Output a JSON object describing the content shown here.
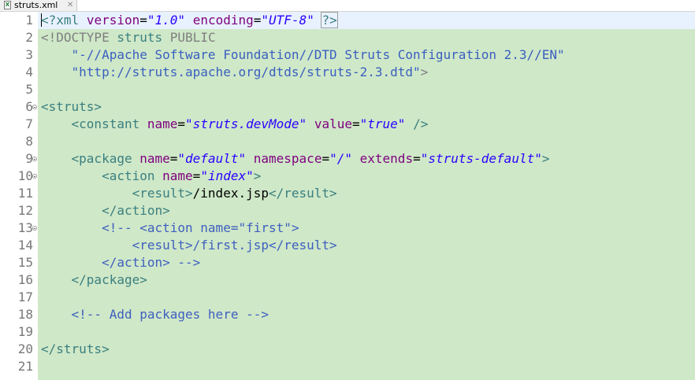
{
  "tab": {
    "file_icon": "X",
    "label": "struts.xml",
    "close_glyph": "✕"
  },
  "colors": {
    "editor_background": "#cfe8c8",
    "current_line": "#e8f2fe",
    "tag": "#3a7f7f",
    "attribute": "#7f007f",
    "attribute_value": "#2a00ff",
    "comment": "#3f5fbf"
  },
  "editor": {
    "current_line": 1,
    "line_numbers": [
      "1",
      "2",
      "3",
      "4",
      "5",
      "6",
      "7",
      "8",
      "9",
      "10",
      "11",
      "12",
      "13",
      "14",
      "15",
      "16",
      "17",
      "18",
      "19",
      "20",
      "21"
    ],
    "fold_lines": [
      6,
      9,
      10,
      13
    ],
    "lines": [
      [
        {
          "c": "t-pi",
          "t": "<?xml"
        },
        {
          "c": "t-text",
          "t": " "
        },
        {
          "c": "t-attr",
          "t": "version"
        },
        {
          "c": "t-text",
          "t": "="
        },
        {
          "c": "t-val",
          "t": "\"1.0\""
        },
        {
          "c": "t-text",
          "t": " "
        },
        {
          "c": "t-attr",
          "t": "encoding"
        },
        {
          "c": "t-text",
          "t": "="
        },
        {
          "c": "t-val",
          "t": "\"UTF-8\""
        },
        {
          "c": "t-text",
          "t": " "
        },
        {
          "c": "t-pi pi-end",
          "t": "?>"
        }
      ],
      [
        {
          "c": "t-doctype",
          "t": "<!DOCTYPE"
        },
        {
          "c": "t-text",
          "t": " "
        },
        {
          "c": "t-dtdname",
          "t": "struts"
        },
        {
          "c": "t-text",
          "t": " "
        },
        {
          "c": "t-kw",
          "t": "PUBLIC"
        }
      ],
      [
        {
          "c": "t-text",
          "t": "    "
        },
        {
          "c": "t-str",
          "t": "\"-//Apache Software Foundation//DTD Struts Configuration 2.3//EN\""
        }
      ],
      [
        {
          "c": "t-text",
          "t": "    "
        },
        {
          "c": "t-str",
          "t": "\"http://struts.apache.org/dtds/struts-2.3.dtd\""
        },
        {
          "c": "t-doctype",
          "t": ">"
        }
      ],
      [],
      [
        {
          "c": "t-tag",
          "t": "<struts>"
        }
      ],
      [
        {
          "c": "t-text",
          "t": "    "
        },
        {
          "c": "t-tag",
          "t": "<constant"
        },
        {
          "c": "t-text",
          "t": " "
        },
        {
          "c": "t-attr",
          "t": "name"
        },
        {
          "c": "t-text",
          "t": "="
        },
        {
          "c": "t-val",
          "t": "\"struts.devMode\""
        },
        {
          "c": "t-text",
          "t": " "
        },
        {
          "c": "t-attr",
          "t": "value"
        },
        {
          "c": "t-text",
          "t": "="
        },
        {
          "c": "t-val",
          "t": "\"true\""
        },
        {
          "c": "t-text",
          "t": " "
        },
        {
          "c": "t-tag",
          "t": "/>"
        }
      ],
      [],
      [
        {
          "c": "t-text",
          "t": "    "
        },
        {
          "c": "t-tag",
          "t": "<package"
        },
        {
          "c": "t-text",
          "t": " "
        },
        {
          "c": "t-attr",
          "t": "name"
        },
        {
          "c": "t-text",
          "t": "="
        },
        {
          "c": "t-val",
          "t": "\"default\""
        },
        {
          "c": "t-text",
          "t": " "
        },
        {
          "c": "t-attr",
          "t": "namespace"
        },
        {
          "c": "t-text",
          "t": "="
        },
        {
          "c": "t-val",
          "t": "\"/\""
        },
        {
          "c": "t-text",
          "t": " "
        },
        {
          "c": "t-attr",
          "t": "extends"
        },
        {
          "c": "t-text",
          "t": "="
        },
        {
          "c": "t-val",
          "t": "\"struts-default\""
        },
        {
          "c": "t-tag",
          "t": ">"
        }
      ],
      [
        {
          "c": "t-text",
          "t": "        "
        },
        {
          "c": "t-tag",
          "t": "<action"
        },
        {
          "c": "t-text",
          "t": " "
        },
        {
          "c": "t-attr",
          "t": "name"
        },
        {
          "c": "t-text",
          "t": "="
        },
        {
          "c": "t-val",
          "t": "\"index\""
        },
        {
          "c": "t-tag",
          "t": ">"
        }
      ],
      [
        {
          "c": "t-text",
          "t": "            "
        },
        {
          "c": "t-tag",
          "t": "<result>"
        },
        {
          "c": "t-text",
          "t": "/index.jsp"
        },
        {
          "c": "t-tag",
          "t": "</result>"
        }
      ],
      [
        {
          "c": "t-text",
          "t": "        "
        },
        {
          "c": "t-tag",
          "t": "</action>"
        }
      ],
      [
        {
          "c": "t-text",
          "t": "        "
        },
        {
          "c": "t-cmt",
          "t": "<!-- <action name=\"first\">"
        }
      ],
      [
        {
          "c": "t-cmt",
          "t": "            <result>/first.jsp</result>"
        }
      ],
      [
        {
          "c": "t-cmt",
          "t": "        </action> -->"
        }
      ],
      [
        {
          "c": "t-text",
          "t": "    "
        },
        {
          "c": "t-tag",
          "t": "</package>"
        }
      ],
      [],
      [
        {
          "c": "t-text",
          "t": "    "
        },
        {
          "c": "t-cmt",
          "t": "<!-- Add packages here -->"
        }
      ],
      [],
      [
        {
          "c": "t-tag",
          "t": "</struts>"
        }
      ],
      []
    ]
  }
}
